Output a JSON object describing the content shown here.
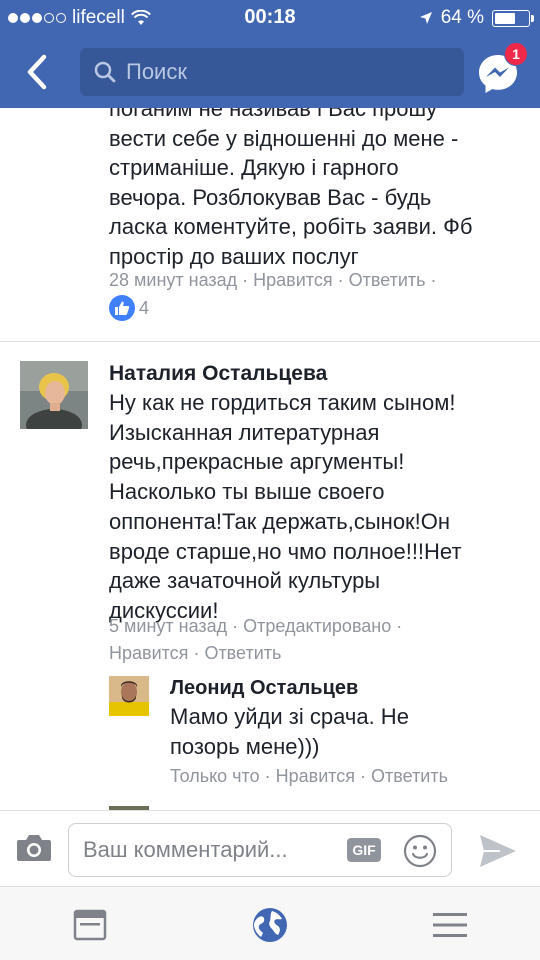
{
  "status_bar": {
    "carrier": "lifecell",
    "time": "00:18",
    "battery": "64 %",
    "battery_level": 0.64
  },
  "header": {
    "search_placeholder": "Поиск",
    "messenger_badge": "1"
  },
  "comments": [
    {
      "text_lines": [
        "поганим не називав і Вас прошу",
        "вести себе у відношенні до мене -",
        "стриманіше. Дякую і гарного",
        "вечора. Розблокував Вас - будь",
        "ласка коментуйте, робіть заяви. Фб",
        "простір до ваших послуг"
      ],
      "time": "28 минут назад",
      "like": "Нравится",
      "reply": "Ответить",
      "trailing_sep": "·",
      "reactions_count": "4"
    },
    {
      "author": "Наталия Остальцева",
      "text_lines": [
        "Ну как не гордиться таким сыном!",
        "Изысканная литературная",
        "речь,прекрасные аргументы!",
        "Насколько ты выше своего",
        "оппонента!Так держать,сынок!Он",
        "вроде старше,но чмо полное!!!Нет",
        "даже зачаточной культуры",
        "дискуссии!"
      ],
      "time": "5 минут назад",
      "edited": "Отредактировано",
      "like": "Нравится",
      "reply": "Ответить"
    },
    {
      "author": "Леонид Остальцев",
      "text_lines": [
        "Мамо уйди зі срача. Не",
        "позорь мене)))"
      ],
      "time": "Только что",
      "like": "Нравится",
      "reply": "Ответить"
    }
  ],
  "composer": {
    "placeholder": "Ваш комментарий...",
    "gif_label": "GIF"
  },
  "icons": {
    "back": "chevron-left-icon",
    "search": "search-icon",
    "messenger": "messenger-icon",
    "camera": "camera-icon",
    "smile": "smile-icon",
    "send": "send-icon",
    "news_feed": "news-feed-icon",
    "notifications": "globe-icon",
    "menu": "menu-icon"
  },
  "colors": {
    "brand": "#4267b2",
    "badge": "#f02849",
    "like": "#4080ff",
    "meta_text": "#90949c"
  }
}
